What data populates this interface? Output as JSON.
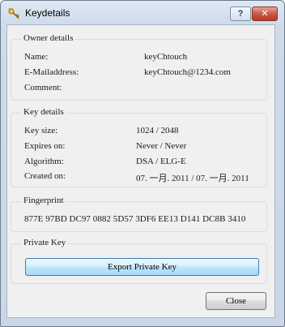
{
  "window": {
    "title": "Keydetails",
    "help_label": "?",
    "close_label": "✕"
  },
  "owner": {
    "title": "Owner details",
    "rows": [
      {
        "label": "Name:",
        "value": "keyChtouch"
      },
      {
        "label": "E-Mailaddress:",
        "value": "keyChtouch@1234.com"
      },
      {
        "label": "Comment:",
        "value": ""
      }
    ]
  },
  "key": {
    "title": "Key details",
    "rows": [
      {
        "label": "Key size:",
        "value": "1024 / 2048"
      },
      {
        "label": "Expires on:",
        "value": "Never / Never"
      },
      {
        "label": "Algorithm:",
        "value": "DSA / ELG-E"
      },
      {
        "label": "Created on:",
        "value": "07. 一月. 2011 / 07. 一月. 2011"
      }
    ]
  },
  "fingerprint": {
    "title": "Fingerprint",
    "value": "877E 97BD DC97 0882 5D57 3DF6 EE13 D141 DC8B 3410"
  },
  "private_key": {
    "title": "Private Key",
    "export_label": "Export Private Key"
  },
  "footer": {
    "close_label": "Close"
  }
}
